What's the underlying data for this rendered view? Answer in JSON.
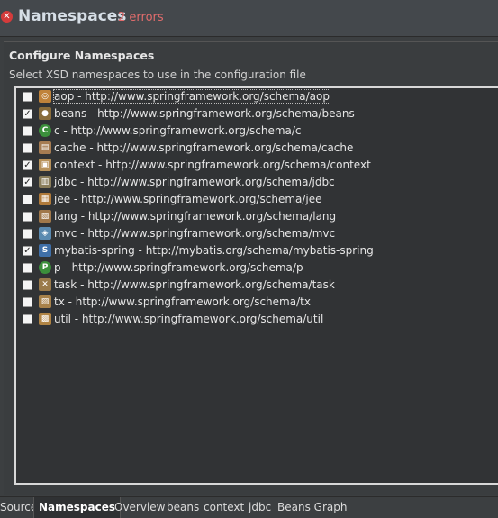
{
  "header": {
    "title": "Namespaces",
    "error_count": "2 errors"
  },
  "section": {
    "title": "Configure Namespaces",
    "description": "Select XSD namespaces to use in the configuration file"
  },
  "namespaces": [
    {
      "label": "aop - http://www.springframework.org/schema/aop",
      "checked": false,
      "icon": "aop-icon",
      "color": "#c0833a"
    },
    {
      "label": "beans - http://www.springframework.org/schema/beans",
      "checked": true,
      "icon": "beans-icon",
      "color": "#8a6d3b"
    },
    {
      "label": "c - http://www.springframework.org/schema/c",
      "checked": false,
      "icon": "c-icon",
      "color": "#3b8f3b"
    },
    {
      "label": "cache - http://www.springframework.org/schema/cache",
      "checked": false,
      "icon": "cache-icon",
      "color": "#a67c52"
    },
    {
      "label": "context - http://www.springframework.org/schema/context",
      "checked": true,
      "icon": "context-icon",
      "color": "#b8925a"
    },
    {
      "label": "jdbc - http://www.springframework.org/schema/jdbc",
      "checked": true,
      "icon": "jdbc-icon",
      "color": "#8a7d5a"
    },
    {
      "label": "jee - http://www.springframework.org/schema/jee",
      "checked": false,
      "icon": "jee-icon",
      "color": "#b07a3a"
    },
    {
      "label": "lang - http://www.springframework.org/schema/lang",
      "checked": false,
      "icon": "lang-icon",
      "color": "#a0784a"
    },
    {
      "label": "mvc - http://www.springframework.org/schema/mvc",
      "checked": false,
      "icon": "mvc-icon",
      "color": "#5a8ab0"
    },
    {
      "label": "mybatis-spring - http://mybatis.org/schema/mybatis-spring",
      "checked": true,
      "icon": "mybatis-spring-icon",
      "color": "#3f6fa8"
    },
    {
      "label": "p - http://www.springframework.org/schema/p",
      "checked": false,
      "icon": "p-icon",
      "color": "#3b8f3b"
    },
    {
      "label": "task - http://www.springframework.org/schema/task",
      "checked": false,
      "icon": "task-icon",
      "color": "#9a7a4a"
    },
    {
      "label": "tx - http://www.springframework.org/schema/tx",
      "checked": false,
      "icon": "tx-icon",
      "color": "#a8824a"
    },
    {
      "label": "util - http://www.springframework.org/schema/util",
      "checked": false,
      "icon": "util-icon",
      "color": "#b08444"
    }
  ],
  "tabs": [
    {
      "label": "Source",
      "active": false
    },
    {
      "label": "Namespaces",
      "active": true
    },
    {
      "label": "Overview",
      "active": false
    },
    {
      "label": "beans",
      "active": false
    },
    {
      "label": "context",
      "active": false
    },
    {
      "label": "jdbc",
      "active": false
    },
    {
      "label": "Beans Graph",
      "active": false
    }
  ]
}
